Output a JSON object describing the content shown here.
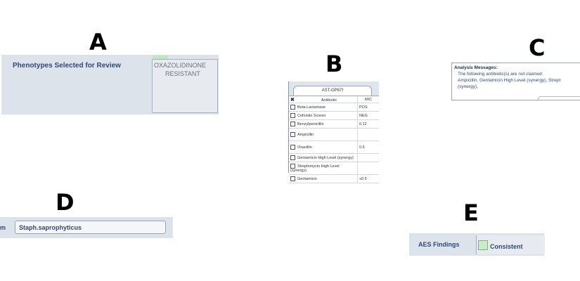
{
  "labels": {
    "a": "A",
    "b": "B",
    "c": "C",
    "d": "D",
    "e": "E"
  },
  "panel_a": {
    "title": "Phenotypes Selected for Review",
    "phenotype_line1": "OXAZOLIDINONE",
    "phenotype_line2": "RESISTANT"
  },
  "panel_b": {
    "tab_label": "AST-GP67",
    "tab_alert": "!",
    "col_antibiotic": "Antibiotic",
    "col_mic": "MIC",
    "rows": [
      {
        "name": "Beta-Lactamase",
        "mic": "POS"
      },
      {
        "name": "Cefoxitin Screen",
        "mic": "NEG"
      },
      {
        "name": "Benzylpenicillin",
        "mic": "0.12"
      },
      {
        "name": "Ampicillin",
        "mic": ""
      },
      {
        "name": "Oxacillin",
        "mic": "0.5"
      },
      {
        "name": "Gentamicin High Level (synergy)",
        "mic": ""
      },
      {
        "name": "Streptomycin High Level (synergy)",
        "mic": ""
      },
      {
        "name": "Gentamicin",
        "mic": "≤0.5"
      }
    ]
  },
  "panel_c": {
    "heading": "Analysis Messages:",
    "line1": "The following antibiotic(s) are not claimed:",
    "line2": "Ampicillin, Gentamicin High Level (synergy), Strept",
    "line3": "(synergy),"
  },
  "panel_d": {
    "label": "m",
    "organism": "Staph.saprophyticus"
  },
  "panel_e": {
    "label": "AES Findings",
    "status": "Consistent",
    "status_color": "#c8ecc7"
  }
}
